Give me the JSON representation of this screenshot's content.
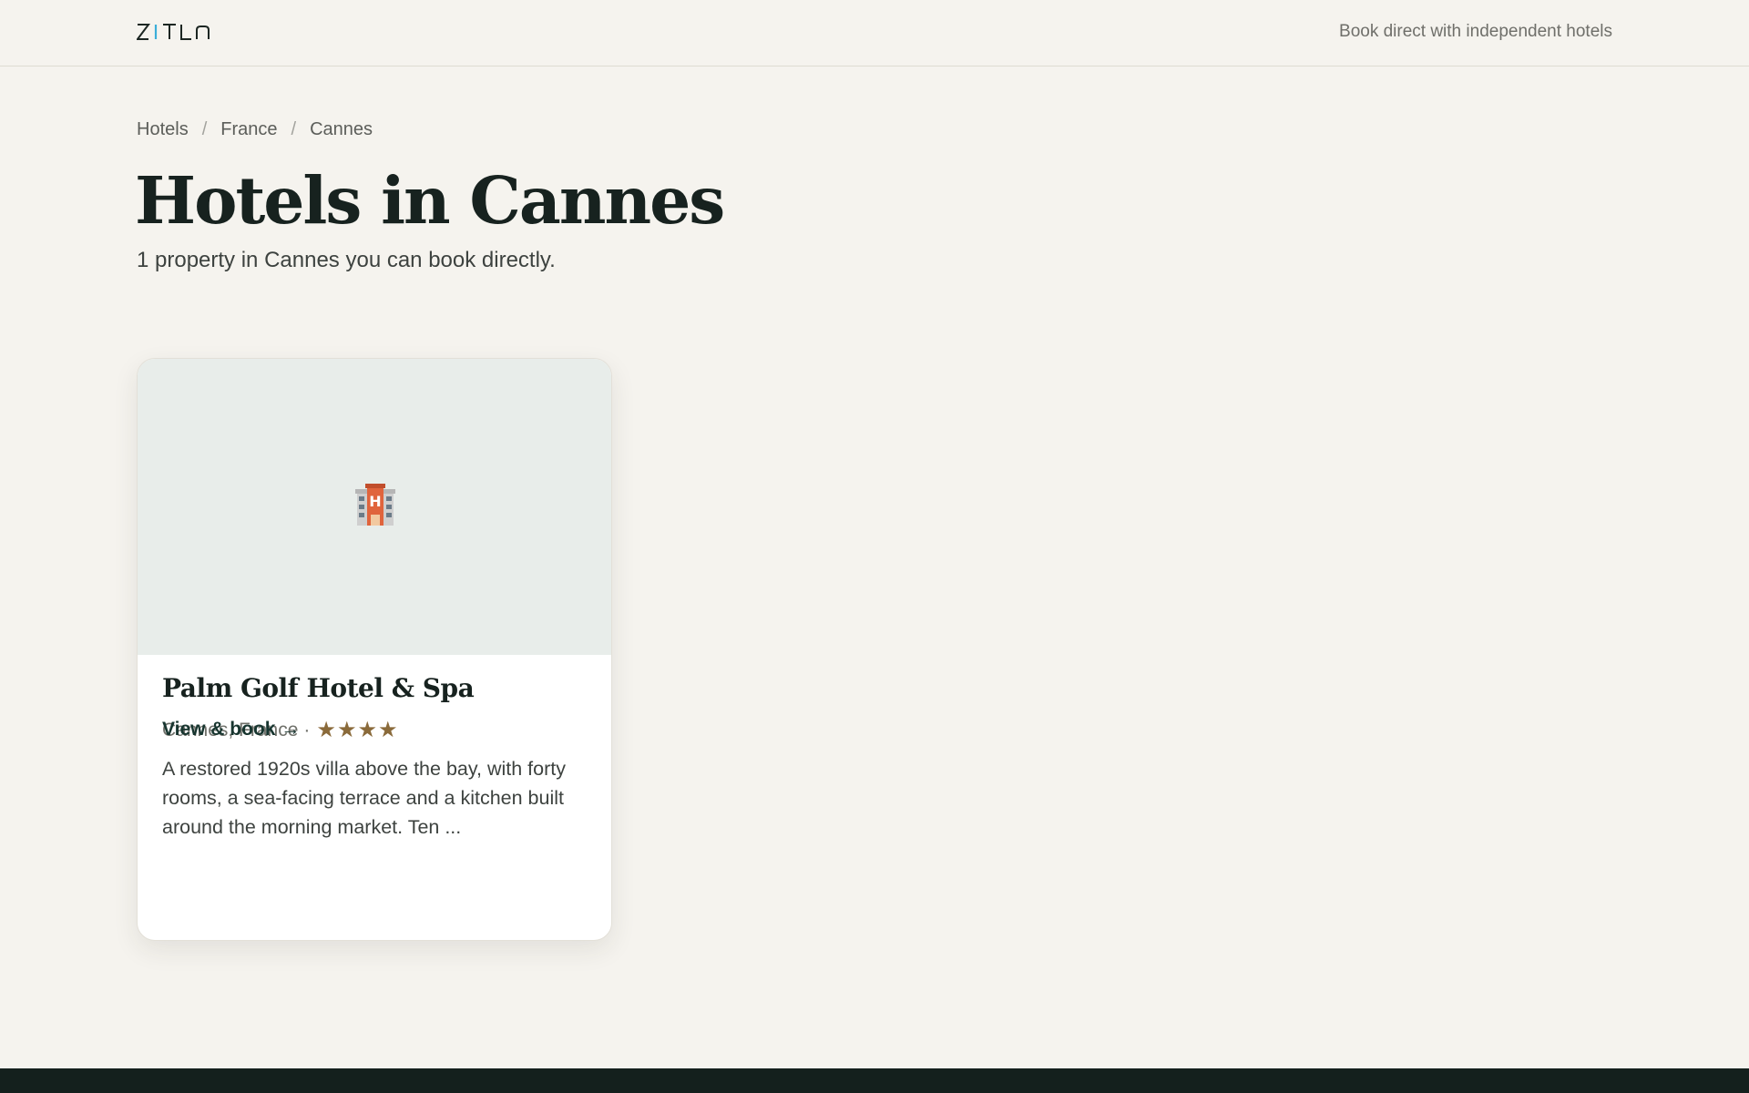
{
  "header": {
    "logo_text": "ZITLIN",
    "tagline": "Book direct with independent hotels"
  },
  "breadcrumb": {
    "items": [
      "Hotels",
      "France",
      "Cannes"
    ],
    "separator": "/"
  },
  "page": {
    "title": "Hotels in Cannes",
    "subtitle": "1 property in Cannes you can book directly."
  },
  "hotels": [
    {
      "icon": "hotel-icon",
      "name": "Palm Golf Hotel & Spa",
      "location": "Cannes, France",
      "meta_separator": "·",
      "stars": "★★★★",
      "star_rating": 4,
      "description": "A restored 1920s villa above the bay, with forty rooms, a sea-facing terrace and a kitchen built around the morning market. Ten ...",
      "cta": "View & book →"
    }
  ],
  "colors": {
    "background": "#f5f3ee",
    "footer": "#14201d",
    "logo_accent": "#3aaed8",
    "star": "#8a6a3a"
  }
}
